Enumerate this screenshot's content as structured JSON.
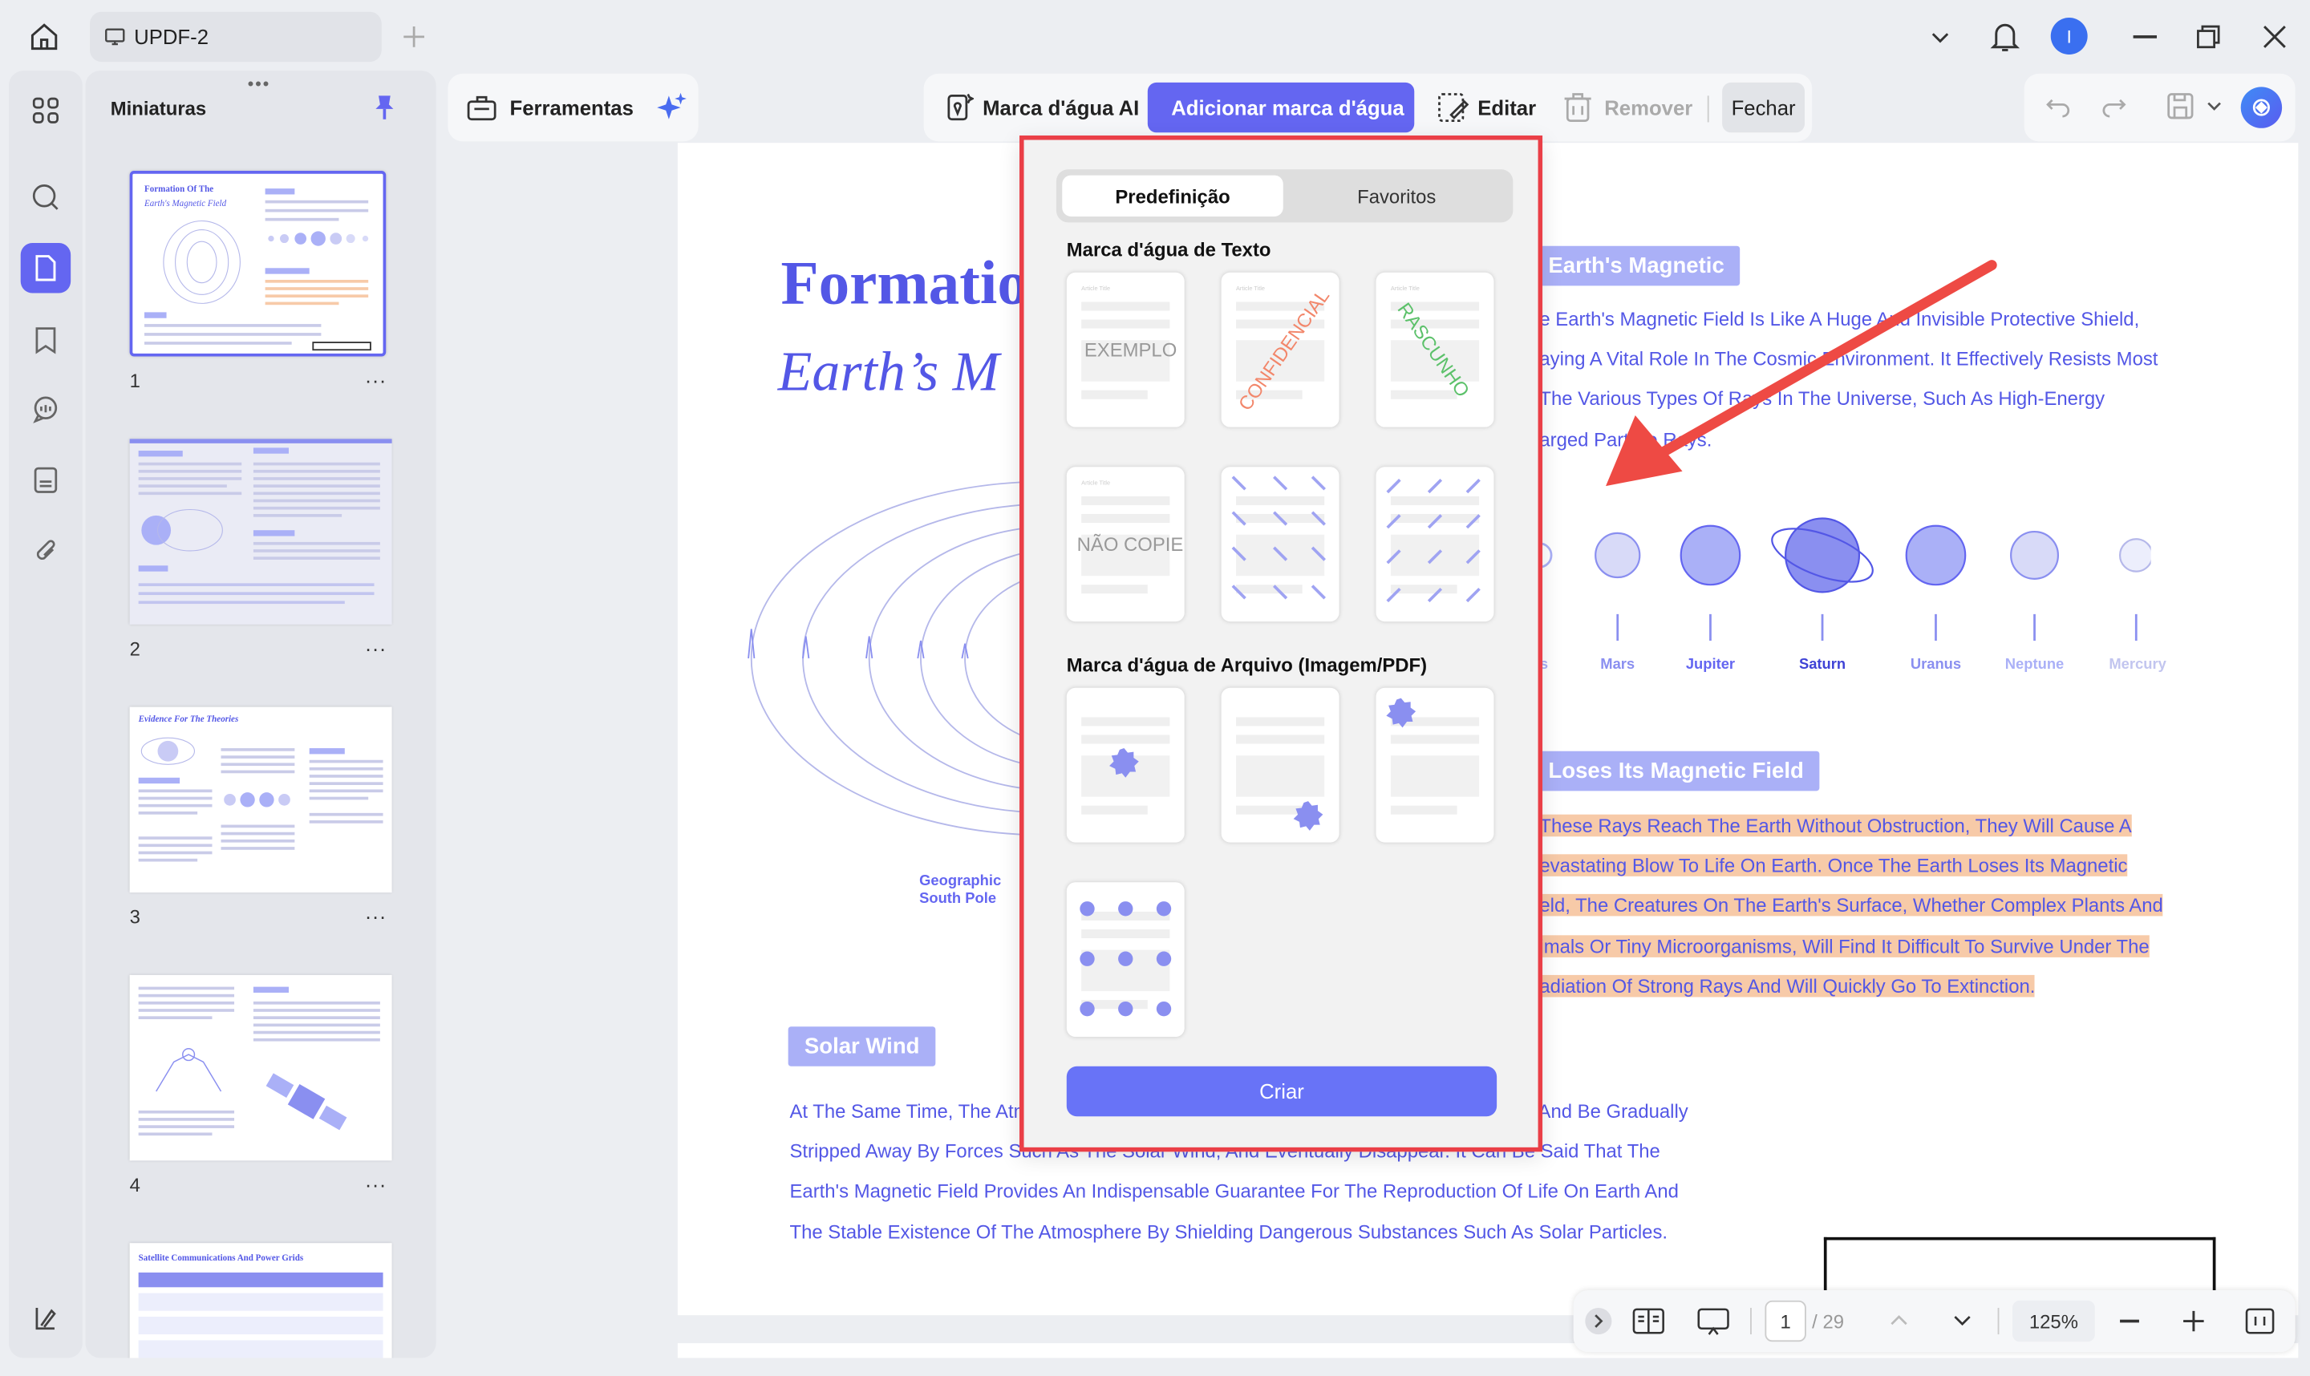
{
  "app": {
    "tab_title": "UPDF-2",
    "accent_color": "#6466f1"
  },
  "thumbnails": {
    "title": "Miniaturas",
    "pages": [
      "1",
      "2",
      "3",
      "4"
    ],
    "more": "...",
    "page5_title": "Satellite Communications And Power Grids"
  },
  "toolbar": {
    "tools_label": "Ferramentas",
    "watermark_ai_label": "Marca d'água AI",
    "add_watermark_label": "Adicionar marca d'água",
    "edit_label": "Editar",
    "remove_label": "Remover",
    "close_label": "Fechar"
  },
  "document": {
    "title_line1": "Formatio",
    "title_line2": "Earth’s M",
    "geo_label_1": "Geographic",
    "geo_label_2": "South Pole",
    "section1_heading": "Earth's Magnetic",
    "section1_lines": [
      "e Earth's Magnetic Field Is Like A Huge And Invisible Protective Shield,",
      "aying A Vital Role In The Cosmic Environment. It Effectively Resists Most",
      "The Various Types Of Rays In The Universe, Such As High-Energy",
      "arged Particle Rays."
    ],
    "planets": [
      "us",
      "Mars",
      "Jupiter",
      "Saturn",
      "Uranus",
      "Neptune",
      "Mercury"
    ],
    "section2_heading": "Loses Its Magnetic Field",
    "section2_lines": [
      "These Rays Reach The Earth Without Obstruction, They Will Cause A",
      "evastating Blow To Life On Earth. Once The Earth Loses Its Magnetic",
      "eld, The Creatures On The Earth's Surface, Whether Complex Plants And",
      "imals Or Tiny Microorganisms, Will Find It Difficult To Survive Under The",
      "adiation Of Strong Rays And Will Quickly Go To Extinction."
    ],
    "solar_wind_heading": "Solar Wind",
    "solar_lines": [
      {
        "left": "At The Same Time, The Atm",
        "right": "And Be Gradually"
      },
      {
        "left": "Stripped Away By Forces Such As The Solar Wind, And Eventually Disappear. It Can Be Said That The",
        "right": ""
      },
      {
        "left": "Earth's Magnetic Field Provides An Indispensable Guarantee For The Reproduction Of Life On Earth And",
        "right": ""
      },
      {
        "left": "The Stable Existence Of The Atmosphere By Shielding Dangerous Substances Such As Solar Particles.",
        "right": ""
      }
    ]
  },
  "watermark_panel": {
    "tab_preset": "Predefinição",
    "tab_favorites": "Favoritos",
    "text_section_title": "Marca d'água de Texto",
    "file_section_title": "Marca d'água de Arquivo (Imagem/PDF)",
    "card_title": "Article Title",
    "text_presets": [
      "EXEMPLO",
      "CONFIDENCIAL",
      "RASCUNHO",
      "NÃO COPIE",
      "RASCUNHO",
      "EXEMPLO"
    ],
    "create_label": "Criar"
  },
  "bottom_bar": {
    "current_page": "1",
    "total_pages": "/ 29",
    "zoom": "125%"
  }
}
